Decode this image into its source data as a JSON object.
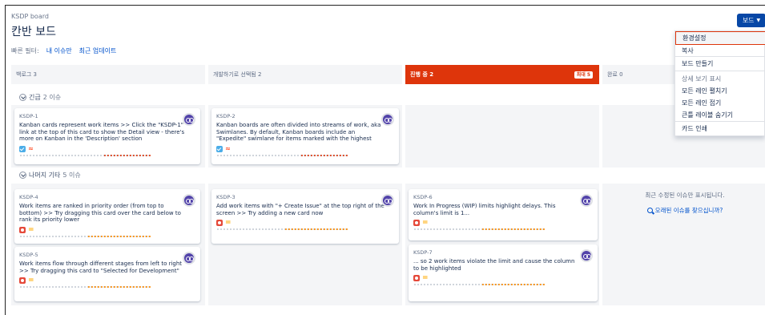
{
  "header": {
    "breadcrumb": "KSDP board",
    "title": "칸반 보드"
  },
  "quick_filters": {
    "label": "빠른 필터:",
    "items": [
      "내 이슈만",
      "최근 업데이트"
    ]
  },
  "board_button": {
    "label": "보드"
  },
  "columns": [
    {
      "label": "백로그 3"
    },
    {
      "label": "개발하기로 선택됨 2"
    },
    {
      "label": "진행 중 2",
      "max_badge": "최대 5"
    },
    {
      "label": "완료 0"
    }
  ],
  "swimlanes": [
    {
      "label": "긴급",
      "count": "2 이슈"
    },
    {
      "label": "나머지 기타",
      "count": "5 이슈"
    }
  ],
  "cards": [
    {
      "key": "KSDP-1",
      "summary": "Kanban cards represent work items >> Click the \"KSDP-1\" link at the top of this card to show the Detail view - there's more on Kanban in the 'Description' section"
    },
    {
      "key": "KSDP-2",
      "summary": "Kanban boards are often divided into streams of work, aka Swimlanes. By default, Kanban boards include an \"Expedite\" swimlane for items marked with the highest"
    },
    {
      "key": "KSDP-4",
      "summary": "Work items are ranked in priority order (from top to bottom) >> Try dragging this card over the card below to rank its priority lower"
    },
    {
      "key": "KSDP-3",
      "summary": "Add work items with \"+ Create Issue\" at the top right of the screen >> Try adding a new card now"
    },
    {
      "key": "KSDP-6",
      "summary": "Work In Progress (WIP) limits highlight delays. This column's limit is 1..."
    },
    {
      "key": "KSDP-5",
      "summary": "Work items flow through different stages from left to right >> Try dragging this card to \"Selected for Development\""
    },
    {
      "key": "KSDP-7",
      "summary": "... so 2 work items violate the limit and cause the column to be highlighted"
    }
  ],
  "done_info": {
    "text": "최근 수정된 이슈만 표시됩니다.",
    "link": "오래된 이슈를 찾으십니까?"
  },
  "dropdown": {
    "items": [
      "환경설정",
      "복사",
      "보드 만들기"
    ],
    "detail_header": "상세 보기 표시",
    "detail_items": [
      "모든 레인 펼치기",
      "모든 레인 접기",
      "큰틀 레이블 숨기기"
    ],
    "print": "카드 인쇄"
  },
  "colors": {
    "accent": "#0747a6",
    "in_progress": "#de350b",
    "link": "#0052cc"
  }
}
